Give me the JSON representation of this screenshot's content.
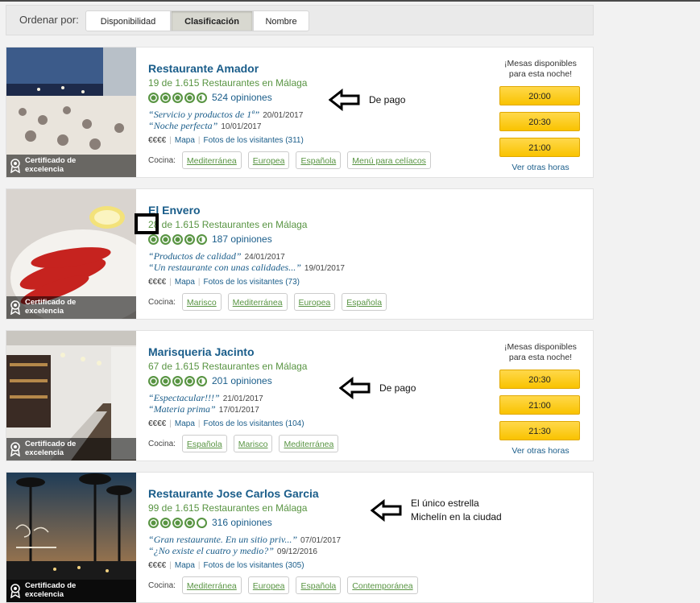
{
  "sort": {
    "label": "Ordenar por:",
    "tabs": [
      "Disponibilidad",
      "Clasificación",
      "Nombre"
    ],
    "active": "Clasificación"
  },
  "certificate_label": "Certificado de excelencia",
  "cuisine_label": "Cocina:",
  "availability": {
    "title_1": "¡Mesas disponibles",
    "title_2": "para esta noche!",
    "more": "Ver otras horas"
  },
  "meta": {
    "price": "€€€€",
    "map": "Mapa",
    "photos_prefix": "Fotos de los visitantes"
  },
  "restaurants": [
    {
      "name": "Restaurante Amador",
      "rank": "19 de 1.615 Restaurantes en Málaga",
      "bubbles": 4.5,
      "reviews": "524 opiniones",
      "quotes": [
        {
          "text": "Servicio y productos de 1ª",
          "date": "20/01/2017"
        },
        {
          "text": "Noche perfecta",
          "date": "10/01/2017"
        }
      ],
      "photos": "(311)",
      "cuisines": [
        "Mediterránea",
        "Europea",
        "Española",
        "Menú para celíacos"
      ],
      "slots": [
        "20:00",
        "20:30",
        "21:00"
      ],
      "annotation": "De pago"
    },
    {
      "name": "El Envero",
      "rank": "28 de 1.615 Restaurantes en Málaga",
      "bubbles": 4.5,
      "reviews": "187 opiniones",
      "quotes": [
        {
          "text": "Productos de calidad",
          "date": "24/01/2017"
        },
        {
          "text": "Un restaurante con unas calidades...",
          "date": "19/01/2017"
        }
      ],
      "photos": "(73)",
      "cuisines": [
        "Marisco",
        "Mediterránea",
        "Europea",
        "Española"
      ],
      "slots": []
    },
    {
      "name": "Marisqueria Jacinto",
      "rank": "67 de 1.615 Restaurantes en Málaga",
      "bubbles": 4.5,
      "reviews": "201 opiniones",
      "quotes": [
        {
          "text": "Espectacular!!!",
          "date": "21/01/2017"
        },
        {
          "text": "Materia prima",
          "date": "17/01/2017"
        }
      ],
      "photos": "(104)",
      "cuisines": [
        "Española",
        "Marisco",
        "Mediterránea"
      ],
      "slots": [
        "20:30",
        "21:00",
        "21:30"
      ],
      "annotation": "De pago"
    },
    {
      "name": "Restaurante Jose Carlos Garcia",
      "rank": "99 de 1.615 Restaurantes en Málaga",
      "bubbles": 4,
      "reviews": "316 opiniones",
      "quotes": [
        {
          "text": "Gran restaurante. En un sitio priv...",
          "date": "07/01/2017"
        },
        {
          "text": "¿No existe el cuatro y medio?",
          "date": "09/12/2016"
        }
      ],
      "photos": "(305)",
      "cuisines": [
        "Mediterránea",
        "Europea",
        "Española",
        "Contemporánea"
      ],
      "slots": [],
      "annotation_1": "El único estrella",
      "annotation_2": "Michelín en la ciudad"
    }
  ]
}
